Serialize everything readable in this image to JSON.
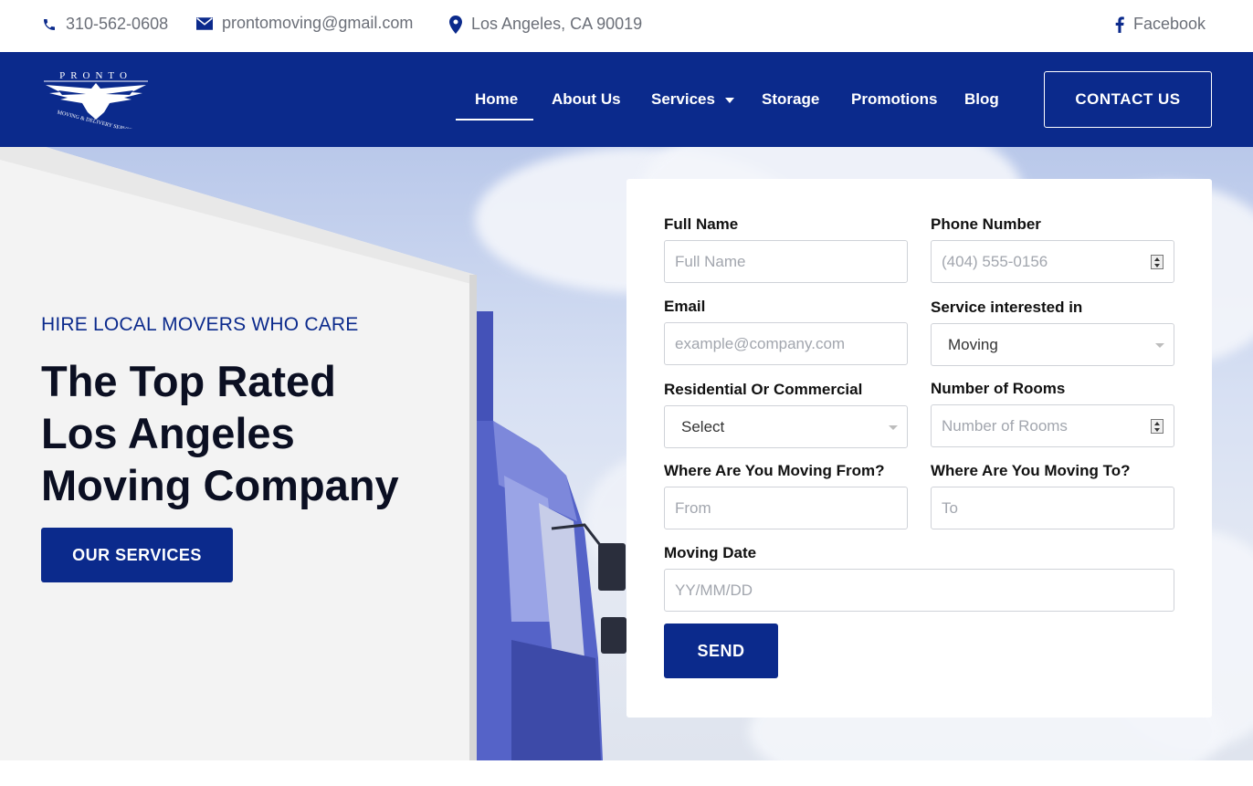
{
  "topbar": {
    "phone": "310-562-0608",
    "email": "prontomoving@gmail.com",
    "address": "Los Angeles, CA 90019",
    "social": "Facebook"
  },
  "nav": {
    "logo_text": "PRONTO",
    "logo_subtext": "MOVING & DELIVERY SERVICE",
    "links": [
      "Home",
      "About Us",
      "Services",
      "Storage",
      "Promotions",
      "Blog"
    ],
    "active": "Home",
    "cta": "CONTACT US"
  },
  "hero": {
    "kicker": "HIRE LOCAL MOVERS WHO CARE",
    "headline_line1": "The Top Rated",
    "headline_line2": "Los Angeles",
    "headline_line3": "Moving Company",
    "button": "OUR SERVICES"
  },
  "form": {
    "full_name": {
      "label": "Full Name",
      "placeholder": "Full Name"
    },
    "phone": {
      "label": "Phone Number",
      "placeholder": "(404) 555-0156"
    },
    "email": {
      "label": "Email",
      "placeholder": "example@company.com"
    },
    "service": {
      "label": "Service interested in",
      "value": "Moving"
    },
    "res_com": {
      "label": "Residential Or Commercial",
      "value": "Select"
    },
    "rooms": {
      "label": "Number of Rooms",
      "placeholder": "Number of Rooms"
    },
    "from": {
      "label": "Where Are You Moving From?",
      "placeholder": "From"
    },
    "to": {
      "label": "Where Are You Moving To?",
      "placeholder": "To"
    },
    "date": {
      "label": "Moving Date",
      "placeholder": "YY/MM/DD"
    },
    "submit": "SEND"
  },
  "colors": {
    "brand": "#0b2a8c",
    "text_muted": "#6b6f78"
  }
}
